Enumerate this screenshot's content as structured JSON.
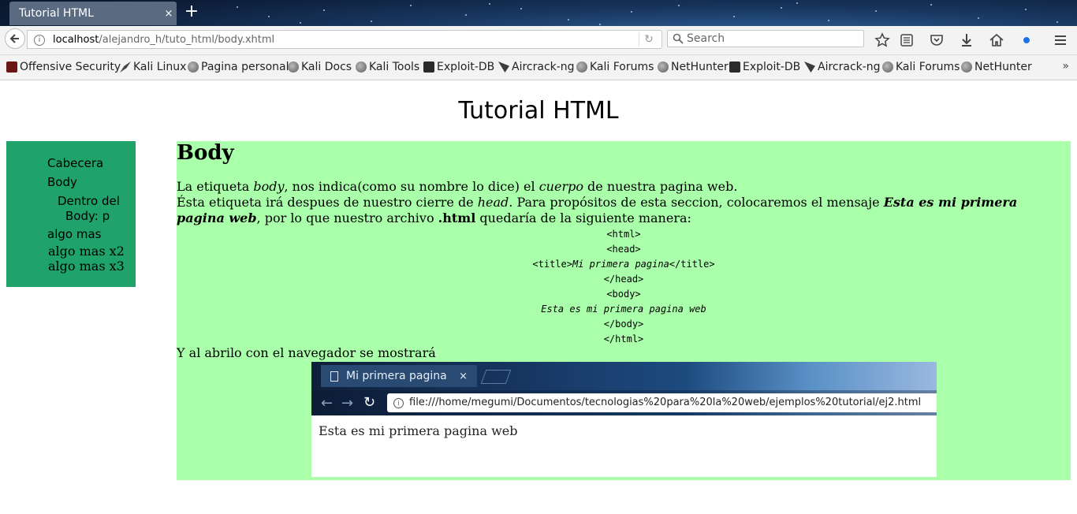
{
  "browser": {
    "tab": {
      "title": "Tutorial HTML",
      "close": "×"
    },
    "new_tab": "+",
    "url": {
      "host": "localhost",
      "path": "/alejandro_h/tuto_html/body.xhtml"
    },
    "search": {
      "placeholder": "Search"
    },
    "bookmarks": [
      {
        "label": "Offensive Security",
        "icon": "offsec-icon"
      },
      {
        "label": "Kali Linux",
        "icon": "kali-icon"
      },
      {
        "label": "Pagina personal",
        "icon": "globe-icon"
      },
      {
        "label": "Kali Docs",
        "icon": "globe-icon"
      },
      {
        "label": "Kali Tools",
        "icon": "globe-icon"
      },
      {
        "label": "Exploit-DB",
        "icon": "exploit-icon"
      },
      {
        "label": "Aircrack-ng",
        "icon": "aircrack-icon"
      },
      {
        "label": "Kali Forums",
        "icon": "globe-icon"
      },
      {
        "label": "NetHunter",
        "icon": "globe-icon"
      },
      {
        "label": "Exploit-DB",
        "icon": "exploit-icon"
      },
      {
        "label": "Aircrack-ng",
        "icon": "aircrack-icon"
      },
      {
        "label": "Kali Forums",
        "icon": "globe-icon"
      },
      {
        "label": "NetHunter",
        "icon": "globe-icon"
      }
    ],
    "bookmarks_overflow": "»"
  },
  "page": {
    "title": "Tutorial HTML",
    "nav": {
      "cabecera": "Cabecera",
      "body": "Body",
      "dentro_line1": "Dentro del",
      "dentro_line2": "Body: p",
      "algo_mas": "algo mas",
      "algo_mas_x2": "algo mas x2",
      "algo_mas_x3": "algo mas x3"
    },
    "content": {
      "heading": "Body",
      "p1": {
        "a": "La etiqueta ",
        "b": "body",
        "c": ", nos indica(como su nombre lo dice) el ",
        "d": "cuerpo",
        "e": " de nuestra pagina web."
      },
      "p2": {
        "a": "Ésta etiqueta irá despues de nuestro cierre de ",
        "b": "head",
        "c": ". Para propósitos de esta seccion, colocaremos el mensaje ",
        "d": "Esta es mi primera pagina web",
        "e": ", por lo que nuestro archivo ",
        "f": ".html",
        "g": " quedaría de la siguiente manera:"
      },
      "code": {
        "html_open": "<html>",
        "head_open": "<head>",
        "title_open": "<title>",
        "title_text": "Mi primera pagina",
        "title_close": "</title>",
        "head_close": "</head>",
        "body_open": "<body>",
        "body_text": "Esta es mi primera pagina web",
        "body_close": "</body>",
        "html_close": "</html>"
      },
      "p3": "Y al abrilo con el navegador se mostrará",
      "screenshot": {
        "tab_title": "Mi primera pagina",
        "tab_close": "×",
        "url": "file:///home/megumi/Documentos/tecnologias%20para%20la%20web/ejemplos%20tutorial/ej2.html",
        "body_text": "Esta es mi primera pagina web"
      }
    }
  },
  "colors": {
    "nav_bg": "#20a26b",
    "content_bg": "#aaffaa"
  }
}
